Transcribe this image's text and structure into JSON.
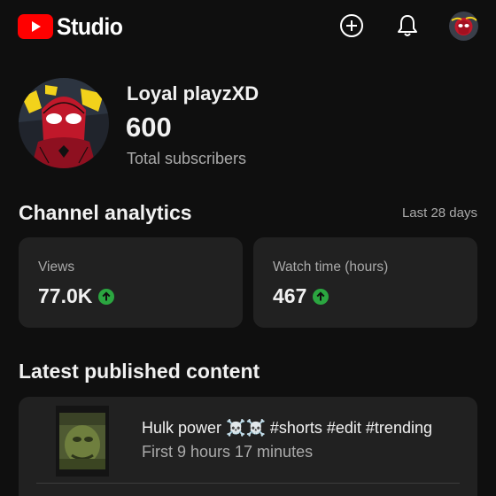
{
  "header": {
    "brand": "Studio",
    "icons": [
      "create-icon",
      "notifications-icon",
      "account-avatar"
    ]
  },
  "channel": {
    "name": "Loyal playzXD",
    "subscribers": "600",
    "subscribers_label": "Total subscribers"
  },
  "analytics": {
    "title": "Channel analytics",
    "period": "Last 28 days",
    "cards": [
      {
        "label": "Views",
        "value": "77.0K",
        "trend": "up"
      },
      {
        "label": "Watch time (hours)",
        "value": "467",
        "trend": "up"
      }
    ]
  },
  "latest": {
    "title": "Latest published content",
    "items": [
      {
        "title": "Hulk power ☠️☠️ #shorts #edit #trending",
        "meta": "First 9 hours 17 minutes"
      }
    ]
  },
  "colors": {
    "background": "#0f0f0f",
    "card": "#212121",
    "brand_red": "#ff0000",
    "trend_green": "#2ba640",
    "secondary_text": "#aaaaaa"
  }
}
